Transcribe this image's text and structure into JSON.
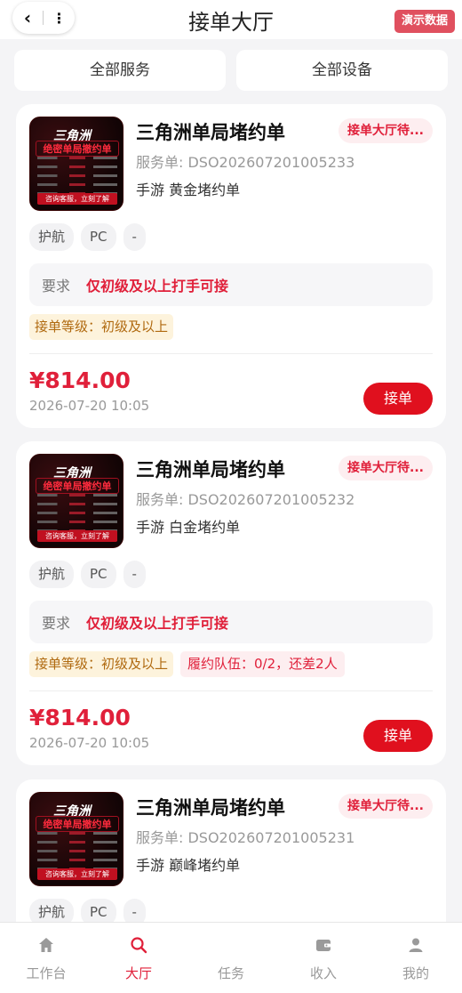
{
  "header": {
    "title": "接单大厅",
    "back_icon": "‹",
    "more_icon": "⋮",
    "demo_label": "演示数据"
  },
  "filters": {
    "service": "全部服务",
    "device": "全部设备"
  },
  "orders": [
    {
      "thumb_title": "三角洲",
      "thumb_subtitle": "绝密单局撤约单",
      "thumb_cta": "咨询客服，立刻了解",
      "title": "三角洲单局堵约单",
      "status": "接单大厅待...",
      "order_no": "服务单: DSO202607201005233",
      "game_type": "手游 黄金堵约单",
      "tags": [
        "护航",
        "PC",
        "-"
      ],
      "requirement_key": "要求",
      "requirement_value": "仅初级及以上打手可接",
      "level_chip": "接单等级：初级及以上",
      "team_chip": "",
      "price": "¥814.00",
      "date": "2026-07-20 10:05",
      "accept_label": "接单"
    },
    {
      "thumb_title": "三角洲",
      "thumb_subtitle": "绝密单局撤约单",
      "thumb_cta": "咨询客服，立刻了解",
      "title": "三角洲单局堵约单",
      "status": "接单大厅待...",
      "order_no": "服务单: DSO202607201005232",
      "game_type": "手游 白金堵约单",
      "tags": [
        "护航",
        "PC",
        "-"
      ],
      "requirement_key": "要求",
      "requirement_value": "仅初级及以上打手可接",
      "level_chip": "接单等级：初级及以上",
      "team_chip": "履约队伍：0/2，还差2人",
      "price": "¥814.00",
      "date": "2026-07-20 10:05",
      "accept_label": "接单"
    },
    {
      "thumb_title": "三角洲",
      "thumb_subtitle": "绝密单局撤约单",
      "thumb_cta": "咨询客服，立刻了解",
      "title": "三角洲单局堵约单",
      "status": "接单大厅待...",
      "order_no": "服务单: DSO202607201005231",
      "game_type": "手游 巅峰堵约单",
      "tags": [
        "护航",
        "PC",
        "-"
      ]
    }
  ],
  "tabbar": {
    "items": [
      {
        "label": "工作台",
        "icon": "home-icon"
      },
      {
        "label": "大厅",
        "icon": "search-icon"
      },
      {
        "label": "任务",
        "icon": "task-icon"
      },
      {
        "label": "收入",
        "icon": "wallet-icon"
      },
      {
        "label": "我的",
        "icon": "user-icon"
      }
    ],
    "active_index": 1
  },
  "colors": {
    "accent": "#e0203a",
    "button": "#e0101e",
    "badge_bg": "#e0505f"
  }
}
